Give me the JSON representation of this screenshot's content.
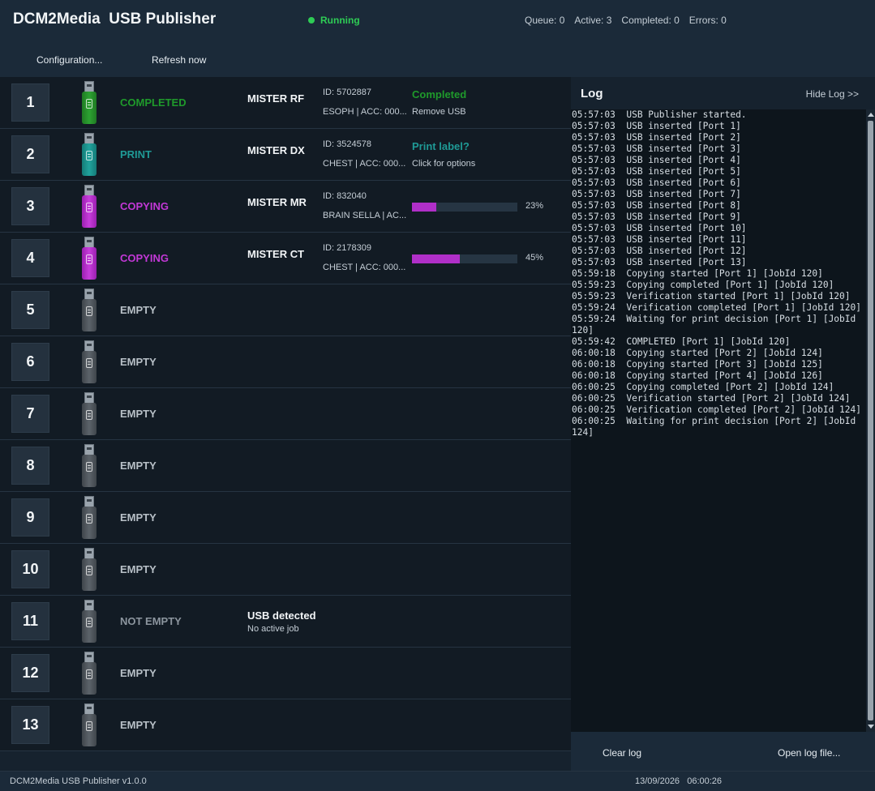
{
  "app": {
    "title": "DCM2Media  USB Publisher",
    "status": "Running",
    "status_color": "#2ecc55"
  },
  "stats": {
    "queue": "Queue: 0",
    "active": "Active: 3",
    "completed": "Completed: 0",
    "errors": "Errors: 0"
  },
  "toolbar": {
    "configuration": "Configuration...",
    "refresh": "Refresh now"
  },
  "ports": [
    {
      "num": "1",
      "state": "COMPLETED",
      "kind": "completed",
      "usb_color": "green",
      "patient": "MISTER RF",
      "id": "ID: 5702887",
      "info": "ESOPH | ACC: 000...",
      "action_title": "Completed",
      "action_sub": "Remove USB"
    },
    {
      "num": "2",
      "state": "PRINT",
      "kind": "print",
      "usb_color": "teal",
      "patient": "MISTER DX",
      "id": "ID: 3524578",
      "info": "CHEST | ACC: 000...",
      "action_title": "Print label?",
      "action_sub": "Click for options"
    },
    {
      "num": "3",
      "state": "COPYING",
      "kind": "copying",
      "usb_color": "magenta",
      "patient": "MISTER MR",
      "id": "ID: 832040",
      "info": "BRAIN SELLA | AC...",
      "progress": 23,
      "progress_label": "23%"
    },
    {
      "num": "4",
      "state": "COPYING",
      "kind": "copying",
      "usb_color": "magenta",
      "patient": "MISTER CT",
      "id": "ID: 2178309",
      "info": "CHEST | ACC: 000...",
      "progress": 45,
      "progress_label": "45%"
    },
    {
      "num": "5",
      "state": "EMPTY",
      "kind": "empty",
      "usb_color": "gray"
    },
    {
      "num": "6",
      "state": "EMPTY",
      "kind": "empty",
      "usb_color": "gray"
    },
    {
      "num": "7",
      "state": "EMPTY",
      "kind": "empty",
      "usb_color": "gray"
    },
    {
      "num": "8",
      "state": "EMPTY",
      "kind": "empty",
      "usb_color": "gray"
    },
    {
      "num": "9",
      "state": "EMPTY",
      "kind": "empty",
      "usb_color": "gray"
    },
    {
      "num": "10",
      "state": "EMPTY",
      "kind": "empty",
      "usb_color": "gray"
    },
    {
      "num": "11",
      "state": "NOT EMPTY",
      "kind": "notempty",
      "usb_color": "gray",
      "detected_title": "USB detected",
      "detected_sub": "No active job"
    },
    {
      "num": "12",
      "state": "EMPTY",
      "kind": "empty",
      "usb_color": "gray"
    },
    {
      "num": "13",
      "state": "EMPTY",
      "kind": "empty",
      "usb_color": "gray"
    }
  ],
  "log": {
    "title": "Log",
    "hide_label": "Hide Log >>",
    "lines": [
      "05:57:03  USB Publisher started.",
      "05:57:03  USB inserted [Port 1]",
      "05:57:03  USB inserted [Port 2]",
      "05:57:03  USB inserted [Port 3]",
      "05:57:03  USB inserted [Port 4]",
      "05:57:03  USB inserted [Port 5]",
      "05:57:03  USB inserted [Port 6]",
      "05:57:03  USB inserted [Port 7]",
      "05:57:03  USB inserted [Port 8]",
      "05:57:03  USB inserted [Port 9]",
      "05:57:03  USB inserted [Port 10]",
      "05:57:03  USB inserted [Port 11]",
      "05:57:03  USB inserted [Port 12]",
      "05:57:03  USB inserted [Port 13]",
      "05:59:18  Copying started [Port 1] [JobId 120]",
      "05:59:23  Copying completed [Port 1] [JobId 120]",
      "05:59:23  Verification started [Port 1] [JobId 120]",
      "05:59:24  Verification completed [Port 1] [JobId 120]",
      "05:59:24  Waiting for print decision [Port 1] [JobId 120]",
      "05:59:42  COMPLETED [Port 1] [JobId 120]",
      "06:00:18  Copying started [Port 2] [JobId 124]",
      "06:00:18  Copying started [Port 3] [JobId 125]",
      "06:00:18  Copying started [Port 4] [JobId 126]",
      "06:00:25  Copying completed [Port 2] [JobId 124]",
      "06:00:25  Verification started [Port 2] [JobId 124]",
      "06:00:25  Verification completed [Port 2] [JobId 124]",
      "06:00:25  Waiting for print decision [Port 2] [JobId 124]"
    ],
    "clear_label": "Clear log",
    "open_label": "Open log file..."
  },
  "statusbar": {
    "version": "DCM2Media USB Publisher   v1.0.0",
    "datetime": "13/09/2026   06:00:26"
  }
}
